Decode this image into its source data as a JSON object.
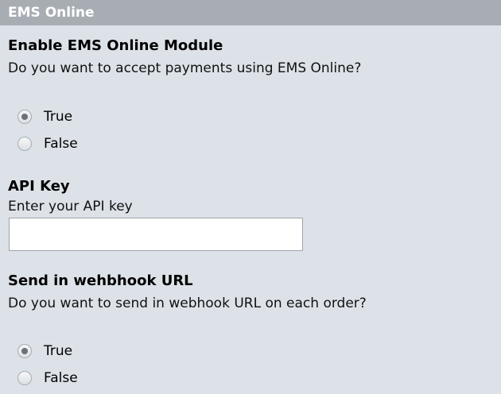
{
  "header": {
    "title": "EMS Online"
  },
  "settings": [
    {
      "title": "Enable EMS Online Module",
      "description": "Do you want to accept payments using EMS Online?",
      "options": [
        {
          "label": "True",
          "selected": true
        },
        {
          "label": "False",
          "selected": false
        }
      ]
    },
    {
      "title": "API Key",
      "description": "Enter your API key",
      "value": "",
      "placeholder": ""
    },
    {
      "title": "Send in wehbhook URL",
      "description": "Do you want to send in webhook URL on each order?",
      "options": [
        {
          "label": "True",
          "selected": true
        },
        {
          "label": "False",
          "selected": false
        }
      ]
    }
  ],
  "colors": {
    "panel_background": "#dde2e8",
    "header_background": "#a8adb4",
    "header_text": "#ffffff"
  }
}
